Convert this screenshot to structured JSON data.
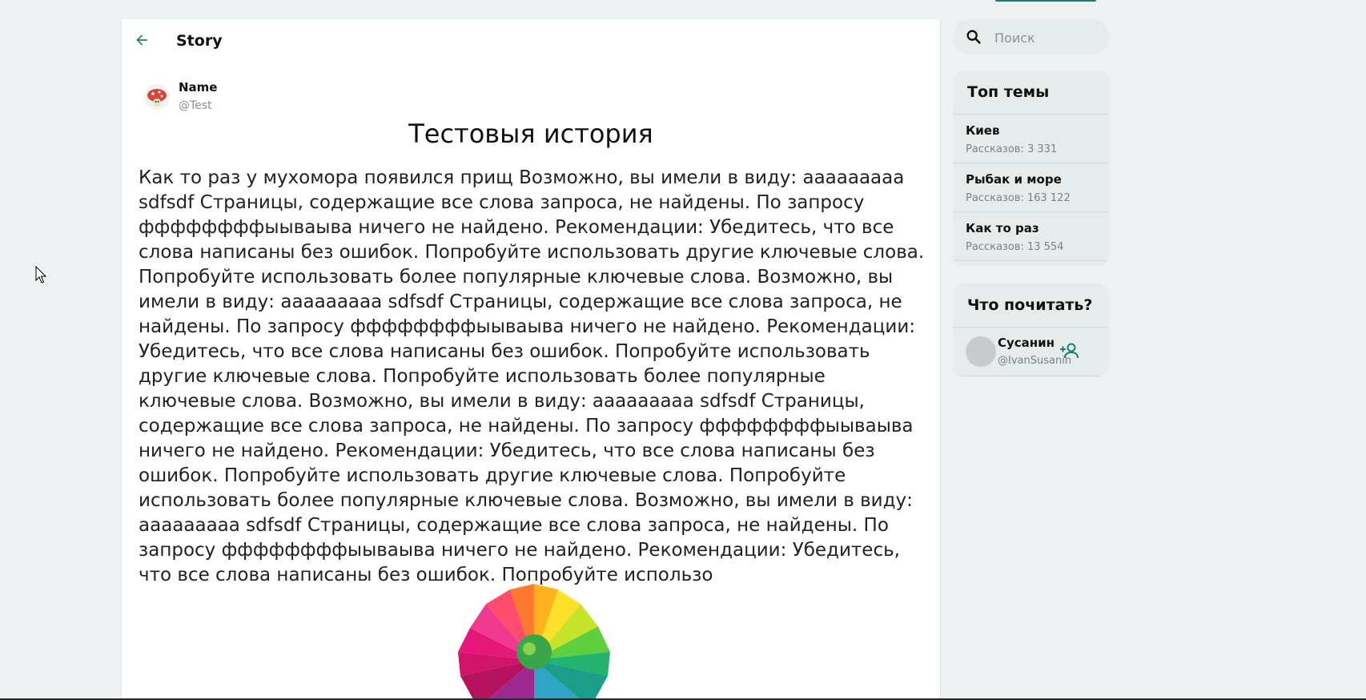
{
  "header": {
    "title": "Story",
    "back_icon": "arrow-left-icon"
  },
  "author": {
    "name": "Name",
    "handle": "@Test"
  },
  "story": {
    "title": "Тестовыя история",
    "text": "Как то раз у мухомора появился прищ Возможно, вы имели в виду: ааааааааа sdfsdf Страницы, содержащие все слова запроса, не найдены. По запросу ффффффффыываыва ничего не найдено. Рекомендации: Убедитесь, что все слова написаны без ошибок. Попробуйте использовать другие ключевые слова. Попробуйте использовать более популярные ключевые слова. Возможно, вы имели в виду: ааааааааа sdfsdf Страницы, содержащие все слова запроса, не найдены. По запросу ффффффффыываыва ничего не найдено. Рекомендации: Убедитесь, что все слова написаны без ошибок. Попробуйте использовать другие ключевые слова. Попробуйте использовать более популярные ключевые слова. Возможно, вы имели в виду: ааааааааа sdfsdf Страницы, содержащие все слова запроса, не найдены. По запросу ффффффффыываыва ничего не найдено. Рекомендации: Убедитесь, что все слова написаны без ошибок. Попробуйте использовать другие ключевые слова. Попробуйте использовать более популярные ключевые слова. Возможно, вы имели в виду: ааааааааа sdfsdf Страницы, содержащие все слова запроса, не найдены. По запросу ффффффффыываыва ничего не найдено. Рекомендации: Убедитесь, что все слова написаны без ошибок. Попробуйте использо"
  },
  "search": {
    "placeholder": "Поиск",
    "value": ""
  },
  "trends": {
    "title": "Топ темы",
    "items": [
      {
        "name": "Киев",
        "count": "Рассказов: 3 331"
      },
      {
        "name": "Рыбак и море",
        "count": "Рассказов: 163 122"
      },
      {
        "name": "Как то раз",
        "count": "Рассказов: 13 554"
      }
    ]
  },
  "suggest": {
    "title": "Что почитать?",
    "users": [
      {
        "name": "Сусанин",
        "handle": "@IvanSusanin",
        "follow_icon": "person-add-icon"
      }
    ]
  },
  "colors": {
    "accent": "#1d7d6d",
    "panel": "#e6ecec",
    "background": "#edf1f1"
  }
}
